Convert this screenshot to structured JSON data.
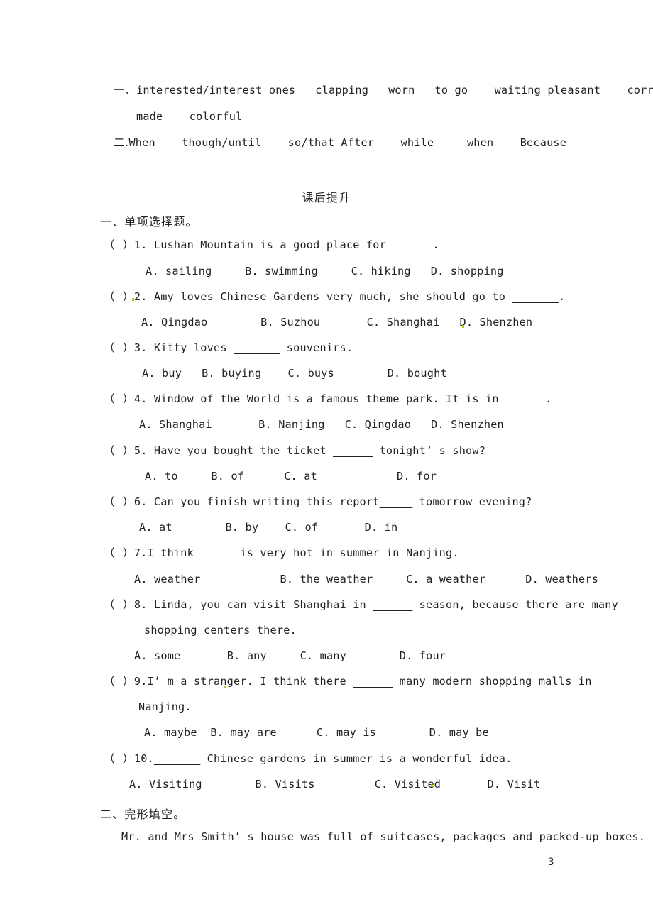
{
  "document": {
    "page_number": "3",
    "answer_key": {
      "section_one_label": "一、",
      "section_one_line1": "interested/interest ones   clapping   worn   to go    waiting pleasant    correcting",
      "section_one_line2": "made    colorful",
      "section_two_label": "二.",
      "section_two_line": "When    though/until    so/that After    while     when    Because"
    },
    "section_heading": "课后提升",
    "part_one": {
      "label": "一、单项选择题。",
      "questions": [
        {
          "marker": "（  ）",
          "number": "1.",
          "stem_before": " Lushan Mountain is a good place for ",
          "blank": "______",
          "stem_after": ".",
          "options": "A. sailing     B. swimming     C. hiking   D. shopping"
        },
        {
          "marker": "（  ）",
          "number": "2.",
          "stem_before": " Amy loves Chinese Gardens very much, she should go to ",
          "blank": "_______",
          "stem_after": ".",
          "options": "A. Qingdao        B. Suzhou       C. Shanghai   D. Shenzhen"
        },
        {
          "marker": "（  ）",
          "number": "3.",
          "stem_before": " Kitty loves ",
          "blank": "_______",
          "stem_after": " souvenirs.",
          "options": "A. buy   B. buying    C. buys        D. bought"
        },
        {
          "marker": "（  ）",
          "number": "4.",
          "stem_before": " Window of the World is a famous theme park. It is in ",
          "blank": "______",
          "stem_after": ".",
          "options": "A. Shanghai       B. Nanjing   C. Qingdao   D. Shenzhen"
        },
        {
          "marker": "（  ）",
          "number": "5.",
          "stem_before": " Have you bought the ticket ",
          "blank": "______",
          "stem_after": " tonight’ s show?",
          "options": "A. to     B. of      C. at            D. for"
        },
        {
          "marker": "（  ）",
          "number": "6.",
          "stem_before": " Can you finish writing this report",
          "blank": "_____",
          "stem_after": " tomorrow evening?",
          "options": "A. at        B. by    C. of       D. in"
        },
        {
          "marker": "（  ）",
          "number": "7.",
          "stem_before": "I think",
          "blank": "______",
          "stem_after": " is very hot in summer in Nanjing.",
          "options": "A. weather            B. the weather     C. a weather      D. weathers"
        },
        {
          "marker": "（  ）",
          "number": "8.",
          "stem_before": " Linda, you can visit Shanghai in ",
          "blank": "______",
          "stem_after": " season, because there are many",
          "continuation": "shopping centers there.",
          "options": "A. some       B. any     C. many        D. four"
        },
        {
          "marker": "（  ）",
          "number": "9.",
          "stem_before": "I’ m a stranger. I think there ",
          "blank": "______",
          "stem_after": " many modern shopping malls in",
          "continuation": "Nanjing.",
          "options": "A. maybe  B. may are      C. may is        D. may be"
        },
        {
          "marker": "（  ）",
          "number": "10.",
          "stem_before": "",
          "blank": "_______",
          "stem_after": " Chinese gardens in summer is a wonderful idea.",
          "options": "A. Visiting        B. Visits         C. Visited       D. Visit"
        }
      ]
    },
    "part_two": {
      "label": "二、完形填空。",
      "passage_line": "Mr. and Mrs Smith’ s house was full of suitcases, packages and packed-up boxes."
    }
  },
  "colors": {
    "text": "#222222",
    "background": "#ffffff",
    "scan_speck": "#b9b400"
  }
}
